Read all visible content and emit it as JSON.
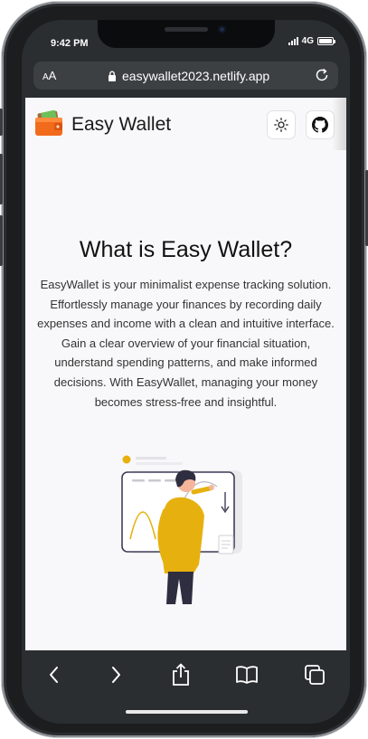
{
  "status_bar": {
    "time": "9:42 PM",
    "network": "4G",
    "battery_percent": 100
  },
  "browser": {
    "text_size_label_small": "A",
    "text_size_label_large": "A",
    "url": "easywallet2023.netlify.app",
    "lock_icon": "lock-icon",
    "reload_icon": "reload-icon"
  },
  "site_header": {
    "brand_name": "Easy Wallet",
    "logo_icon": "wallet-icon",
    "theme_toggle_icon": "sun-icon",
    "github_icon": "github-icon"
  },
  "hero": {
    "title": "What is Easy Wallet?",
    "description": "EasyWallet is your minimalist expense tracking solution. Effortlessly manage your finances by recording daily expenses and income with a clean and intuitive interface. Gain a clear overview of your financial situation, understand spending patterns, and make informed decisions. With EasyWallet, managing your money becomes stress-free and insightful."
  },
  "toolbar": {
    "back_icon": "chevron-left-icon",
    "forward_icon": "chevron-right-icon",
    "share_icon": "share-icon",
    "bookmarks_icon": "book-icon",
    "tabs_icon": "tabs-icon"
  },
  "colors": {
    "brand_orange": "#f26a1b",
    "illustration_yellow": "#e6b10e",
    "page_background": "#f8f8fa",
    "browser_chrome": "#2a2e31"
  }
}
